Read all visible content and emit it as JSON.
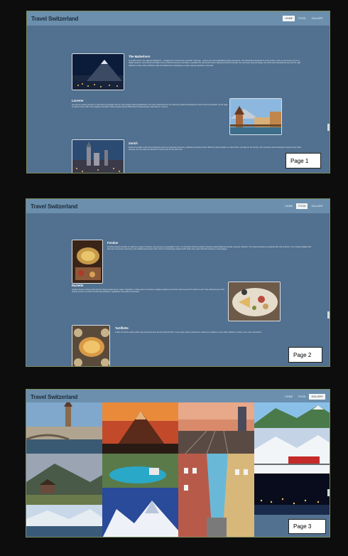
{
  "page1": {
    "brand": "Travel Switzerland",
    "nav": [
      "HOME",
      "FOOD",
      "GALLERY"
    ],
    "active_nav": 0,
    "label": "Page 1",
    "articles": [
      {
        "title": "The Matterhorn",
        "text": "At 4,478 metres, the majestic Matterhorn - certainly the most famous mountain in Europe - towers over the breathtaking Alpine panorama. The Switzerland landmark is at the border of the summit teems some of Italian between. Cervinil and the Italian resort of Breuil-Cervinia, and offers a paradise the all-rounder that is taking the almost and path. Its symmetric pyramid shape, the rocks teeth standing the sky and the rigid reflection of the mastry. Multitud make the Matterhorn's landscape a unique natural spectacle in Zermatt."
      },
      {
        "title": "Lucerne",
        "text": "The city of Lucerne (Luzern in German) is a popular stop for most people visiting Switzerland. The city is well known for its charming medieval architecture and its stunning location on the edge of Lake Lucerne with snow capped mountains. Swiss people leaving Switzerland speak at least a few days in Lucerne."
      },
      {
        "title": "Zurich",
        "text": "Zurich is located in the heart of Europe and is an important economic, political and tourist center. With its unique location on Lake Zurich, the Alps on the horizon, the numerous tourist attraction areas and its urban diversity, the city offers an attractive environment for the wild work."
      }
    ]
  },
  "page2": {
    "brand": "Travel Switzerland",
    "nav": [
      "HOME",
      "FOOD",
      "GALLERY"
    ],
    "active_nav": 1,
    "label": "Page 2",
    "articles": [
      {
        "title": "Fondue",
        "text": "Fondue (cheese fondue) is made from types of cheese, one among a comparable in one. It is important that the product (cheeses used) ideally Emmental, Gruyere, Vacherin. The cheese fondue is prepared with cherry kirsch. It is a cheap platable dish that was previously used only by the traditional purposes. But now it is increasingly replaced with white wine, goes well with cheeses in champagne."
      },
      {
        "title": "Raclette",
        "text": "Another famous cheese dish that the Swiss people like to make is Raclette. A wheel piece of cheese is slightly heated over the fire until one part of it starts to melt. That softened part of the cheese is then cut off and served with potatoes, vegetables, like pickles and bread."
      },
      {
        "title": "Tartiflette",
        "text": "A dish of French cuisine which was assumed more French Swiss border. It very tasty, hearty casserole is made from potatoes, cream with reblochon cheese, sour cream and bacon."
      }
    ]
  },
  "page3": {
    "brand": "Travel Switzerland",
    "nav": [
      "HOME",
      "FOOD",
      "GALLERY"
    ],
    "active_nav": 2,
    "label": "Page 3"
  }
}
